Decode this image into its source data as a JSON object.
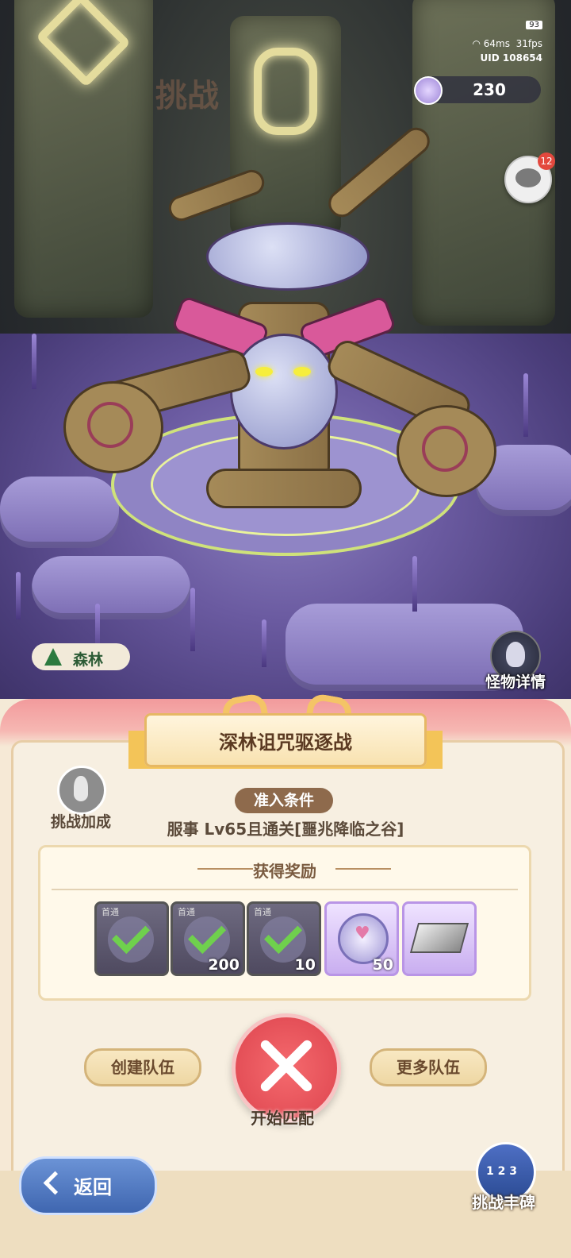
{
  "status_bar": {
    "battery": "93",
    "ping": "64ms",
    "fps": "31fps",
    "uid": "UID 108654"
  },
  "currency": {
    "icon": "crystal-coin-icon",
    "value": "230"
  },
  "chat": {
    "icon": "chat-bubbles-icon",
    "badge": "12"
  },
  "scene": {
    "faded_title": "挑战",
    "environment_label": "森林",
    "environment_icon": "pine-tree-icon"
  },
  "monster_detail": {
    "icon": "monster-head-icon",
    "label": "怪物详情"
  },
  "panel": {
    "title": "深林诅咒驱逐战",
    "bonus": {
      "icon": "cheering-person-icon",
      "label": "挑战加成"
    },
    "entry_condition_label": "准入条件",
    "entry_condition_text": "服事  Lv65且通关[噩兆降临之谷]",
    "rewards": {
      "header": "获得奖励",
      "items": [
        {
          "tag": "首通",
          "claimed": true,
          "count": "",
          "icon": "crest-emblem-icon"
        },
        {
          "tag": "首通",
          "claimed": true,
          "count": "200",
          "icon": "blue-star-icon"
        },
        {
          "tag": "首通",
          "claimed": true,
          "count": "10",
          "icon": "brown-star-icon"
        },
        {
          "tag": "",
          "claimed": false,
          "count": "50",
          "icon": "heart-coin-icon"
        },
        {
          "tag": "",
          "claimed": false,
          "count": "",
          "icon": "silver-ingot-icon"
        }
      ]
    },
    "create_team_label": "创建队伍",
    "more_teams_label": "更多队伍",
    "start_match_label": "开始匹配",
    "start_match_icon": "crossed-swords-icon"
  },
  "footer": {
    "back_label": "返回",
    "back_icon": "back-arrow-icon",
    "monument_label": "挑战丰碑",
    "monument_icon": "ranking-monument-icon"
  }
}
